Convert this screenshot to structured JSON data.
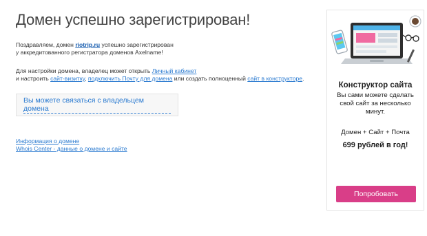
{
  "page": {
    "title": "Домен успешно зарегистрирован!"
  },
  "congrats": {
    "prefix": "Поздравляем, домен ",
    "domain": "riotrip.ru",
    "suffix": " успешно зарегистрирован",
    "line2": "у аккредитованного регистратора доменов Axelname!"
  },
  "setup": {
    "line1_prefix": "Для настройки домена, владелец может открыть ",
    "cabinet_link": "Личный кабинет",
    "line2_prefix": "и настроить ",
    "card_site_link": "сайт-визитку",
    "sep": ", ",
    "mail_link": "подключить Почту для домена",
    "mid_text": " или создать полноценный ",
    "builder_link": "сайт в конструкторе",
    "end": "."
  },
  "contact": {
    "link": "Вы можете связаться с владельцем домена"
  },
  "info_links": {
    "domain_info": "Информация о домене",
    "whois": "Whois Center - данные о домене и сайте"
  },
  "ad": {
    "title": "Конструктор сайта",
    "text": "Вы сами можете сделать свой сайт за несколько минут.",
    "combo": "Домен + Сайт + Почта",
    "price": "699 рублей в год!",
    "button": "Попробовать",
    "accent_color": "#d93e88"
  }
}
